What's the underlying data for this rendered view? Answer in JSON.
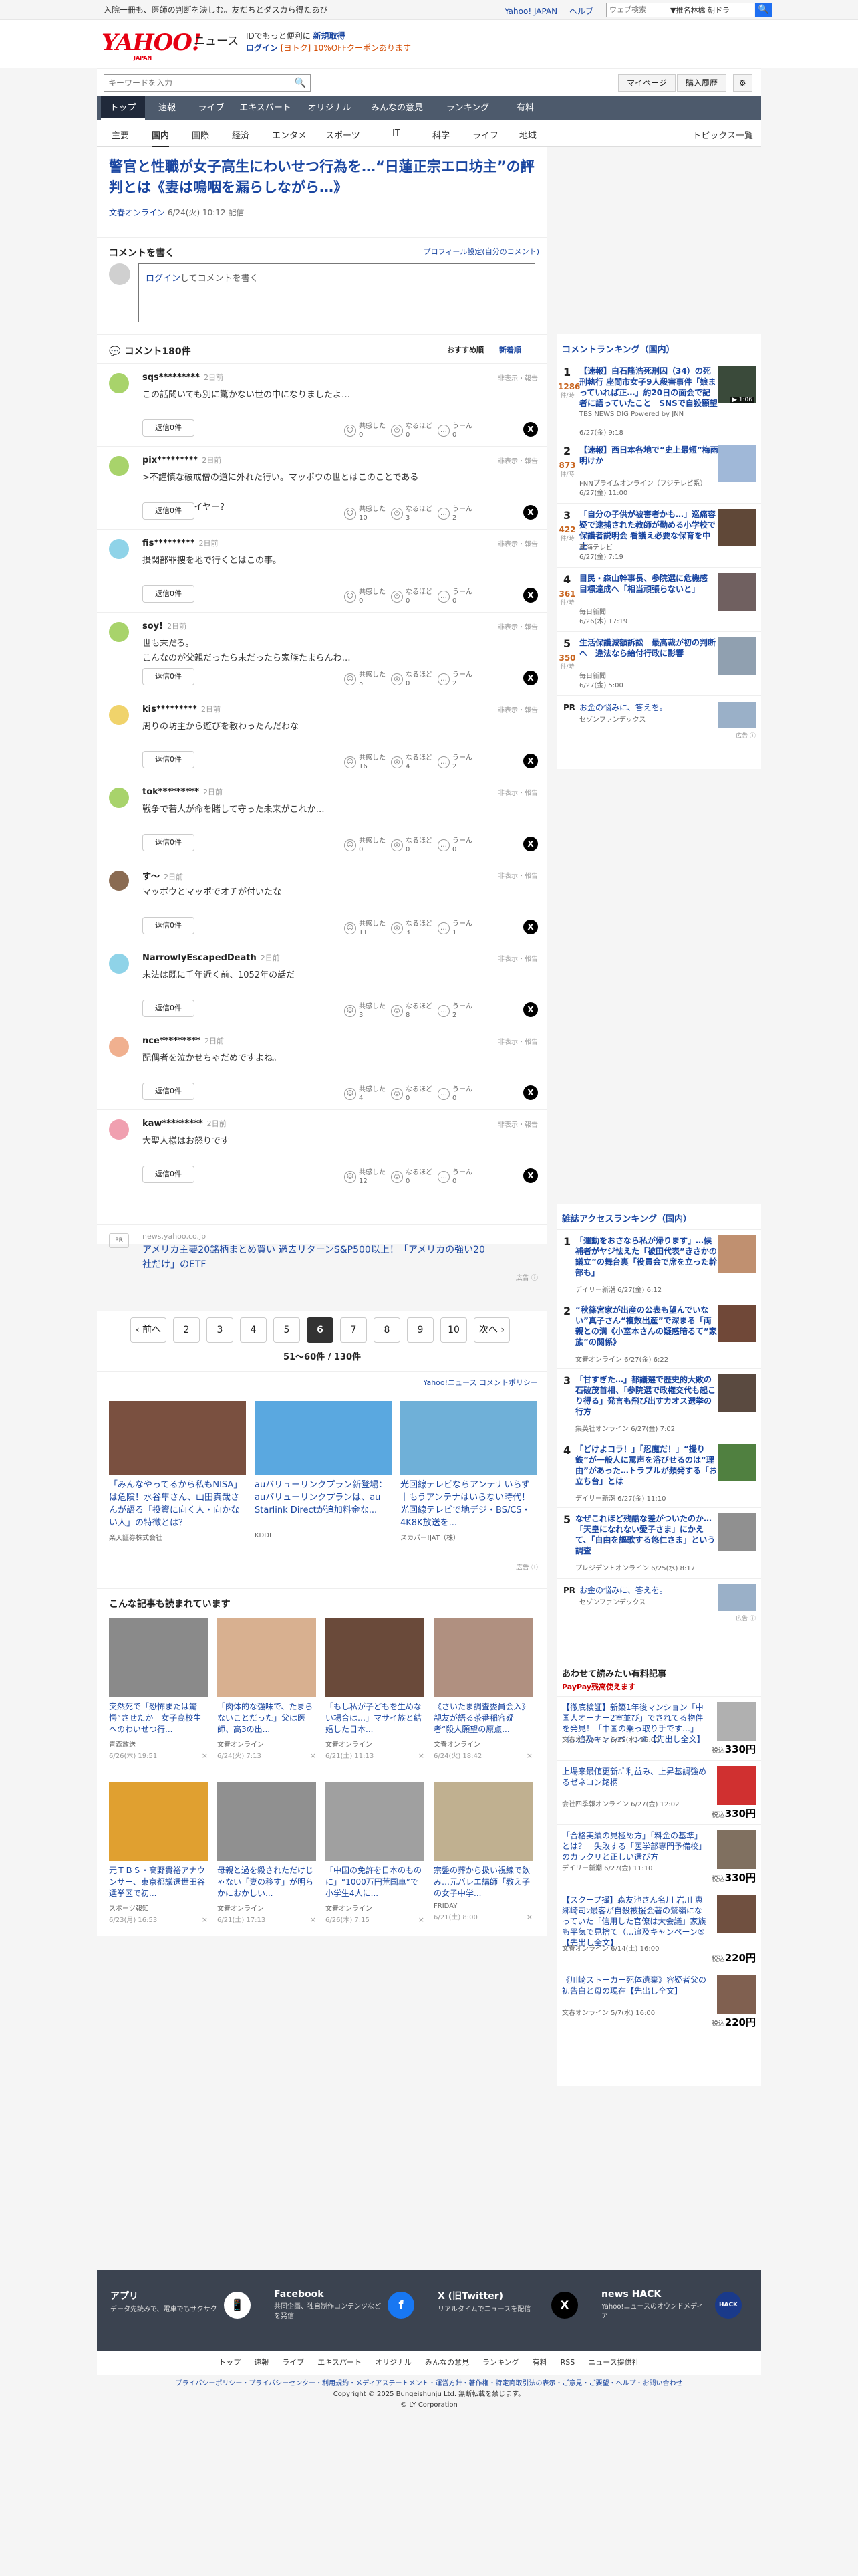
{
  "topbar": {
    "promo": "入院一冊も、医師の判断を決しむ。友だちとダスカら得たあび",
    "links": [
      "Yahoo! JAPAN",
      "ヘルプ"
    ],
    "search_placeholder": "ウェブ検索",
    "search_select": "▼推名林檎 朝ドラ",
    "search_icon": "🔍"
  },
  "header": {
    "logo": "YAHOO!",
    "logo_sub": "JAPAN",
    "service": "ニュース",
    "promo_line1": "IDでもっと便利に",
    "promo_signup": "新規取得",
    "promo_login": "ログイン",
    "promo_badge": "[ヨトク] 10%OFFクーポンあります"
  },
  "bar2": {
    "search_placeholder": "キーワードを入力",
    "search_icon": "🔍",
    "mypage": "マイページ",
    "history": "購入履歴",
    "settings_icon": "⚙"
  },
  "mainnav": [
    "トップ",
    "速報",
    "ライブ",
    "エキスパート",
    "オリジナル",
    "みんなの意見",
    "ランキング",
    "有料"
  ],
  "subnav": {
    "items": [
      "主要",
      "国内",
      "国際",
      "経済",
      "エンタメ",
      "スポーツ",
      "IT",
      "科学",
      "ライフ",
      "地域"
    ],
    "right": "トピックス一覧"
  },
  "article": {
    "title": "警官と性職が女子高生にわいせつ行為を…“日蓮正宗エロ坊主”の評判とは《妻は鳴咽を漏らしながら…》",
    "source": "文春オンライン",
    "date": "6/24(火) 10:12 配信"
  },
  "comment_form": {
    "title": "コメントを書く",
    "profile": "プロフィール設定(自分のコメント)",
    "login": "ログイン",
    "placeholder": "してコメントを書く"
  },
  "comments_header": {
    "count": "コメント180件",
    "sort1": "おすすめ順",
    "sort2": "新着順",
    "icon": "💬"
  },
  "reaction_labels": {
    "agree": "共感した",
    "insight": "なるほど",
    "hmm": "うーん"
  },
  "reply_label": "返信0件",
  "flag_label": "非表示・報告",
  "comments": [
    {
      "user": "sqs*********",
      "time": "2日前",
      "text": "この話聞いても別に驚かない世の中になりましたよ…",
      "a": "0",
      "b": "0",
      "c": "0",
      "color": "#a8d36b"
    },
    {
      "user": "pix*********",
      "time": "2日前",
      "text": ">不謹慎な破戒僧の道に外れた行い。マッポウの世とはこのことである\n\nニンジャスレイヤー？",
      "a": "10",
      "b": "3",
      "c": "2",
      "color": "#a8d36b"
    },
    {
      "user": "fis*********",
      "time": "2日前",
      "text": "摂関部罪捜を地で行くとはこの事。",
      "a": "0",
      "b": "0",
      "c": "0",
      "color": "#8fd3e8"
    },
    {
      "user": "soy!",
      "time": "2日前",
      "text": "世も末だろ。\nこんなのが父親だったら末だったら家族たまらんわ…",
      "a": "5",
      "b": "0",
      "c": "2",
      "color": "#a8d36b"
    },
    {
      "user": "kis*********",
      "time": "2日前",
      "text": "周りの坊主から遊びを教わったんだわな",
      "a": "16",
      "b": "4",
      "c": "2",
      "color": "#f0d36b"
    },
    {
      "user": "tok*********",
      "time": "2日前",
      "text": "戦争で若人が命を賭して守った未来がこれか…",
      "a": "0",
      "b": "0",
      "c": "0",
      "color": "#a8d36b"
    },
    {
      "user": "す〜",
      "time": "2日前",
      "text": "マッポウとマッポでオチが付いたな",
      "a": "11",
      "b": "3",
      "c": "1",
      "color": "#8a6b52"
    },
    {
      "user": "NarrowlyEscapedDeath",
      "time": "2日前",
      "text": "末法は既に千年近く前、1052年の話だ",
      "a": "3",
      "b": "8",
      "c": "2",
      "color": "#8fd3e8"
    },
    {
      "user": "nce*********",
      "time": "2日前",
      "text": "配偶者を泣かせちゃだめですよね。",
      "a": "4",
      "b": "0",
      "c": "0",
      "color": "#f0b08f"
    },
    {
      "user": "kaw*********",
      "time": "2日前",
      "text": "大聖人様はお怒りです",
      "a": "12",
      "b": "0",
      "c": "0",
      "color": "#f0a0b0"
    }
  ],
  "inline_ad": {
    "label": "PR",
    "domain": "news.yahoo.co.jp",
    "title": "アメリカ主要20銘柄まとめ買い 過去リターンS&P500以上！「アメリカの強い20社だけ」のETF",
    "footer": "広告 ⓘ"
  },
  "pager": {
    "prev": "‹ 前へ",
    "pages": [
      "2",
      "3",
      "4",
      "5",
      "6",
      "7",
      "8",
      "9",
      "10"
    ],
    "active": "6",
    "next": "次へ ›",
    "count": "51〜60件 / 130件"
  },
  "policy": "Yahoo!ニュース コメントポリシー",
  "ads": [
    {
      "title": "「みんなやってるから私もNISA」は危険！水谷隼さん、山田真哉さんが語る「投資に向く人・向かない人」の特徴とは？",
      "sponsor": "楽天証券株式会社",
      "color": "#7a5040"
    },
    {
      "title": "auバリューリンクプラン新登場：auバリューリンクプランは、au Starlink Directが追加料金な...",
      "sponsor": "KDDI",
      "color": "#5aa8e0"
    },
    {
      "title": "光回線テレビならアンテナいらず｜もうアンテナはいらない時代！光回線テレビで地デジ・BS/CS・4K8K放送を...",
      "sponsor": "スカパー!JAT（株）",
      "color": "#6fb0d8"
    }
  ],
  "ads_footer": "広告 ⓘ",
  "related": {
    "title": "こんな記事も読まれています",
    "items": [
      {
        "title": "突然死で「恐怖または驚愕”させたか　女子高校生へのわいせつ行...",
        "src": "青森放送",
        "date": "6/26(木) 19:51",
        "color": "#8a8a8a"
      },
      {
        "title": "「肉体的な強味で、たまらないことだった」父は医師、高3の出...",
        "src": "文春オンライン",
        "date": "6/24(火) 7:13",
        "color": "#d8b090"
      },
      {
        "title": "「もし私が子どもを生めない場合は…」マサイ族と結婚した日本...",
        "src": "文春オンライン",
        "date": "6/21(土) 11:13",
        "color": "#6a4a3a"
      },
      {
        "title": "《さいたま調査委員会入》親友が語る茶番稲容疑者“殺人願望の原点...",
        "src": "文春オンライン",
        "date": "6/24(火) 18:42",
        "color": "#b09080"
      },
      {
        "title": "元ＴＢＳ・高野貴裕アナウンサー、東京都議選世田谷選挙区で初...",
        "src": "スポーツ報知",
        "date": "6/23(月) 16:53",
        "color": "#e0a030"
      },
      {
        "title": "母親と過を殺されただけじゃない「妻の移す」が明らかにおかしい...",
        "src": "文春オンライン",
        "date": "6/21(土) 17:13",
        "color": "#909090"
      },
      {
        "title": "「中国の免許を日本のものに」“1000万円荒国車”で小学生4人に...",
        "src": "文春オンライン",
        "date": "6/26(木) 7:15",
        "color": "#a0a0a0"
      },
      {
        "title": "宗盤の葬から扱い視線で飲み…元バレエ講師「教え子の女子中学...",
        "src": "FRIDAY",
        "date": "6/21(土) 8:00",
        "color": "#c0b090"
      }
    ]
  },
  "ranking": {
    "title": "コメントランキング（国内）",
    "unit": "件/時",
    "items": [
      {
        "t": "【速報】白石隆浩死刑囚（34）の死刑執行 座間市女子9人殺害事件「娘まっていれば正…」約20日の面会で記者に語っていたこと　SNSで自殺願望ある人を誘い出す",
        "s": "TBS NEWS DIG Powered by JNN",
        "d": "6/27(金) 9:18",
        "c": "1286",
        "th": "#3a4a3a",
        "vid": "▶ 1:06"
      },
      {
        "t": "【速報】西日本各地で“史上最短”梅雨明けか",
        "s": "FNNプライムオンライン（フジテレビ系）",
        "d": "6/27(金) 11:00",
        "c": "873",
        "th": "#a0b8d8",
        "vid": ""
      },
      {
        "t": "「自分の子供が被害者かも…」巡痛容疑で逮捕された教師が勤める小学校で保護者説明会 看護え必要な保育を中止",
        "s": "東海テレビ",
        "d": "6/27(金) 7:19",
        "c": "422",
        "th": "#604838",
        "vid": ""
      },
      {
        "t": "目民・森山幹事長、参院選に危機感　目標達成へ「相当頑張らないと」",
        "s": "毎日新聞",
        "d": "6/26(木) 17:19",
        "c": "361",
        "th": "#706060",
        "vid": ""
      },
      {
        "t": "生活保護減額訴訟　最高裁が初の判断へ　違法なら給付行政に影響",
        "s": "毎日新聞",
        "d": "6/27(金) 5:00",
        "c": "350",
        "th": "#90a0b0",
        "vid": ""
      }
    ]
  },
  "ranking_pr": {
    "label": "PR",
    "title": "お金の悩みに、答えを。",
    "src": "セゾンファンデックス",
    "footer": "広告 ⓘ"
  },
  "ranking2": {
    "title": "雑誌アクセスランキング（国内）",
    "items": [
      {
        "t": "「運動をおさなら私が帰ります」…候補者がヤジ怯えた「被田代表”きさかの議立”の舞台裏「役員会で席を立った幹部も」",
        "s": "デイリー新潮 6/27(金) 6:12",
        "th": "#c09070"
      },
      {
        "t": "“秋篠宮家が出産の公表も望んでいない”真子さん“複数出産”で深まる「両親との溝《小室本さんの疑惑暗るて”家族”の関係》",
        "s": "文春オンライン 6/27(金) 6:22",
        "th": "#704838"
      },
      {
        "t": "「甘すぎた…」都議選で歴史的大敗の石破茂首相、「参院選で政権交代も起こり得る」発言も飛び出すカオス選挙の行方",
        "s": "集英社オンライン 6/27(金) 7:02",
        "th": "#5a4a40"
      },
      {
        "t": "「どけよコラ！」「忍魔だ！」“撮り鉄”が一般人に罵声を浴びせるのは“理由”があった…トラブルが頻発する「お立ち台」とは",
        "s": "デイリー新潮 6/27(金) 11:10",
        "th": "#508040"
      },
      {
        "t": "なぜこれほど残酷な差がついたのか…「天皇になれない愛子さま」にかえて、「自由を謳歌する悠仁さま」という調査",
        "s": "プレジデントオンライン 6/25(水) 8:17",
        "th": "#909090"
      }
    ]
  },
  "ranking2_pr": {
    "label": "PR",
    "title": "お金の悩みに、答えを。",
    "src": "セゾンファンデックス",
    "footer": "広告 ⓘ"
  },
  "shopping": {
    "title": "あわせて読みたい有料記事",
    "paypay": "PayPay残高使えます",
    "price_prefix": "税込",
    "items": [
      {
        "t": "【徹底検証】新築1年後マンション「中国人オーナー2室並び」でされてる物件を発見！「中国の乗っ取り手です…」（...追及キャンペーン⑥【先出し全文】",
        "s": "文春オンライン 6/25(水) 16:00",
        "p": "330円",
        "th": "#b0b0b0"
      },
      {
        "t": "上場来最値更新ﾊﾞ利益み、上昇基調強めるゼネコン銘柄",
        "s": "会社四季報オンライン 6/27(金) 12:02",
        "p": "330円",
        "th": "#d03030"
      },
      {
        "t": "「合格実績の見極め方」「料金の基準」とは？　失敗する「医学部専門予備校」のカラクリと正しい選び方",
        "s": "デイリー新潮 6/27(金) 11:10",
        "p": "330円",
        "th": "#807060"
      },
      {
        "t": "【スクープ撮】森友池さん名川 岩川 恵 郷崎司ﾝ最客が自殺被援会著の鷲嶺になっていた「信用した官僚は大会議」家族も平気で見捨て（...追及キャンペーン⑤【先出し全文】",
        "s": "文春オンライン 6/14(土) 16:00",
        "p": "220円",
        "th": "#705040"
      },
      {
        "t": "《川崎ストーカー死体遺棄》容疑者父の初告白と母の現在【先出し全文】",
        "s": "文春オンライン 5/7(水) 16:00",
        "p": "220円",
        "th": "#806050"
      }
    ]
  },
  "footer": {
    "items": [
      {
        "n": "アプリ",
        "d": "データ先読みで、電車でもサクサク",
        "ic": "📱"
      },
      {
        "n": "Facebook",
        "d": "共同企画、独自制作コンテンツなどを発信",
        "ic": "f"
      },
      {
        "n": "X (旧Twitter)",
        "d": "リアルタイムでニュースを配信",
        "ic": "X"
      },
      {
        "n": "news HACK",
        "d": "Yahoo!ニュースのオウンドメディア",
        "ic": "HACK"
      }
    ],
    "nav": [
      "トップ",
      "速報",
      "ライブ",
      "エキスパート",
      "オリジナル",
      "みんなの意見",
      "ランキング",
      "有料",
      "RSS",
      "ニュース提供社"
    ],
    "legal_links": "プライバシーポリシー・プライバシーセンター・利用規約・メディアステートメント・運営方針・著作権・特定商取引法の表示・ご意見・ご要望・ヘルプ・お問い合わせ",
    "copyright": "Copyright © 2025 Bungeishunju Ltd. 無断転載を禁じます。",
    "copyright2": "© LY Corporation"
  }
}
